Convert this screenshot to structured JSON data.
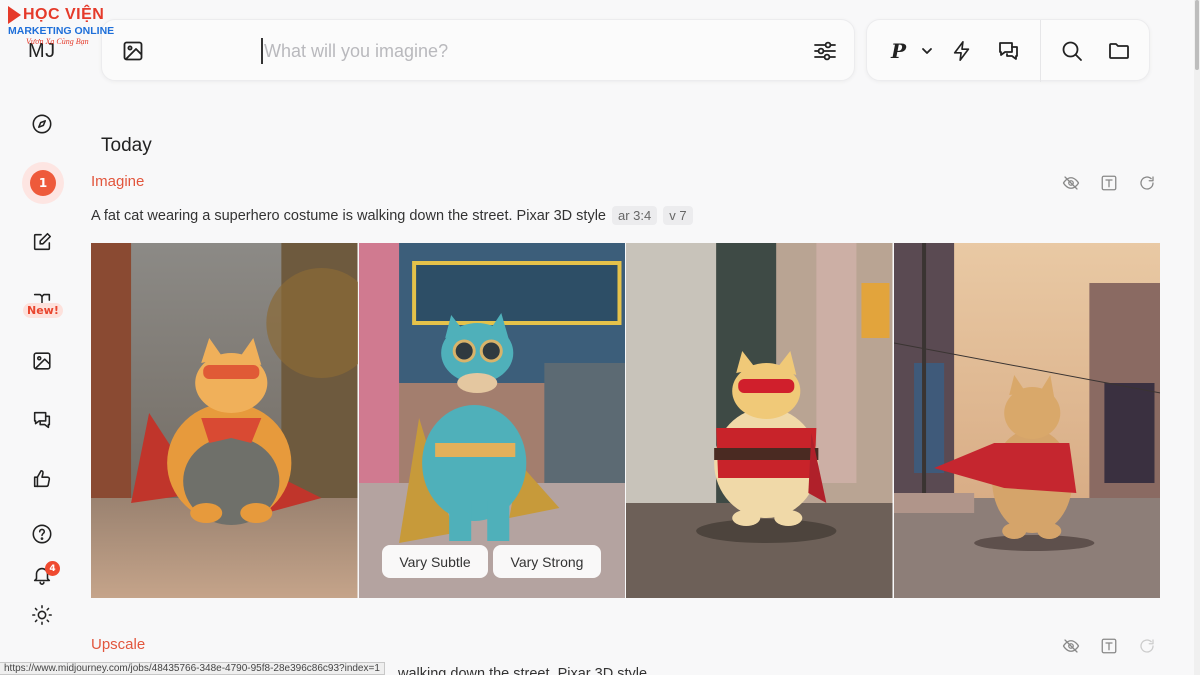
{
  "watermark": {
    "line1": "HỌC VIỆN",
    "line2": "MARKETING ONLINE",
    "line3": "Vươn Xa Cùng Bạn"
  },
  "sidebar": {
    "brand": "MJ",
    "notification_count_badge": "1",
    "new_tag": "New!",
    "alerts_badge": "4",
    "items": [
      {
        "icon": "compass-icon"
      },
      {
        "icon": "create-badge"
      },
      {
        "icon": "edit-icon"
      },
      {
        "icon": "book-icon"
      },
      {
        "icon": "image-icon"
      },
      {
        "icon": "chat-icon"
      },
      {
        "icon": "thumbs-up-icon"
      },
      {
        "icon": "help-icon"
      },
      {
        "icon": "bell-icon"
      },
      {
        "icon": "sun-icon"
      }
    ]
  },
  "search": {
    "placeholder": "What will you imagine?",
    "value": ""
  },
  "toolbar": {
    "profile_label": "P"
  },
  "content": {
    "section_title": "Today",
    "jobs": [
      {
        "type_label": "Imagine",
        "prompt": "A fat cat wearing a superhero costume is walking down the street. Pixar 3D style",
        "params": [
          "ar 3:4",
          "v 7"
        ],
        "images": [
          {
            "alt": "Orange cat with red mask and cape in brick alley"
          },
          {
            "alt": "Cat in teal superhero suit with goggles on city street"
          },
          {
            "alt": "Cat with red mask and red superhero suit on street"
          },
          {
            "alt": "Cat with red cape walking away on sunset street"
          }
        ],
        "vary_buttons": [
          "Vary Subtle",
          "Vary Strong"
        ]
      },
      {
        "type_label": "Upscale",
        "prompt_tail": "walking down the street. Pixar 3D style"
      }
    ]
  },
  "status_url": "https://www.midjourney.com/jobs/48435766-348e-4790-95f8-28e396c86c93?index=1",
  "colors": {
    "accent": "#e2563d",
    "badge": "#ee5a3b",
    "background": "#f8f8f9"
  }
}
